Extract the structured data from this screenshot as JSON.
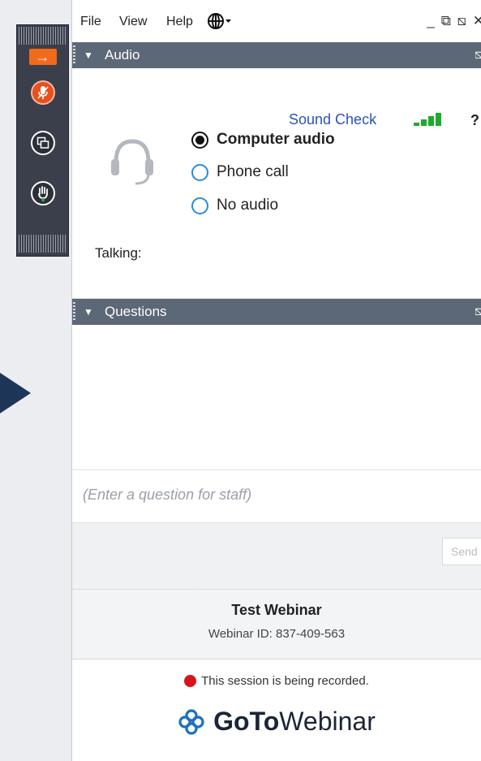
{
  "menu": {
    "file": "File",
    "view": "View",
    "help": "Help",
    "globe_icon": "globe-icon",
    "window_controls": [
      "_",
      "⧉",
      "⧅",
      "✕"
    ]
  },
  "toolbar": {
    "icons": [
      "arrow-right-icon",
      "microphone-muted-icon",
      "screen-share-icon",
      "raise-hand-icon"
    ],
    "accent": "#f26a1b"
  },
  "audio_panel": {
    "title": "Audio",
    "sound_check": "Sound Check",
    "help": "?",
    "options": [
      {
        "label": "Computer audio",
        "selected": true
      },
      {
        "label": "Phone call",
        "selected": false
      },
      {
        "label": "No audio",
        "selected": false
      }
    ],
    "talking_label": "Talking:"
  },
  "questions_panel": {
    "title": "Questions",
    "placeholder": "(Enter a question for staff)",
    "send_label": "Send"
  },
  "info": {
    "title": "Test Webinar",
    "webinar_id": "Webinar ID: 837-409-563",
    "recording_notice": "This session is being recorded.",
    "brand_bold": "GoTo",
    "brand_light": "Webinar"
  },
  "colors": {
    "header_bg": "#5c6777",
    "link": "#2a53b8",
    "signal": "#1faa2e",
    "recording": "#d8141b"
  }
}
